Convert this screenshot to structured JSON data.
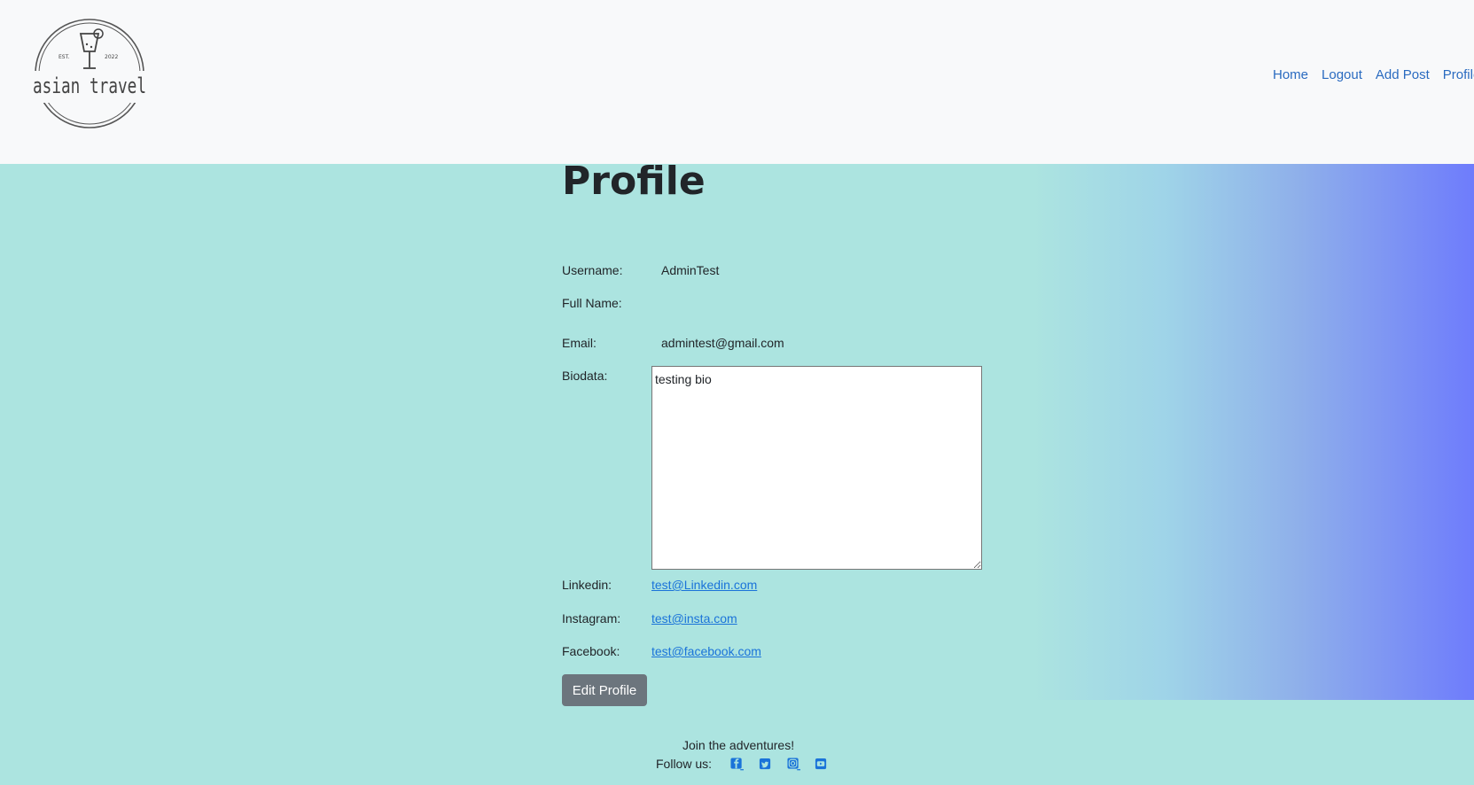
{
  "navbar": {
    "logo_text": "asian travel",
    "logo_est": "EST.",
    "logo_year": "2022",
    "links": [
      "Home",
      "Logout",
      "Add Post",
      "Profile"
    ]
  },
  "profile": {
    "title": "Profile",
    "username_label": "Username:",
    "username_value": "AdminTest",
    "fullname_label": "Full Name:",
    "fullname_value": "",
    "email_label": "Email:",
    "email_value": "admintest@gmail.com",
    "biodata_label": "Biodata:",
    "biodata_value": "testing bio",
    "linkedin_label": "Linkedin:",
    "linkedin_value": "test@Linkedin.com",
    "instagram_label": "Instagram:",
    "instagram_value": "test@insta.com",
    "facebook_label": "Facebook:",
    "facebook_value": "test@facebook.com",
    "edit_button": "Edit Profile"
  },
  "footer": {
    "tagline": "Join the adventures!",
    "follow_label": "Follow us:",
    "social_icons": [
      "facebook-icon",
      "twitter-icon",
      "instagram-icon",
      "youtube-icon"
    ]
  },
  "colors": {
    "background": "#ace4e0",
    "gradient_end": "#6e7cfc",
    "navbar_bg": "#f8f9fa",
    "link": "#2a6bc0",
    "button": "#6c757d"
  }
}
